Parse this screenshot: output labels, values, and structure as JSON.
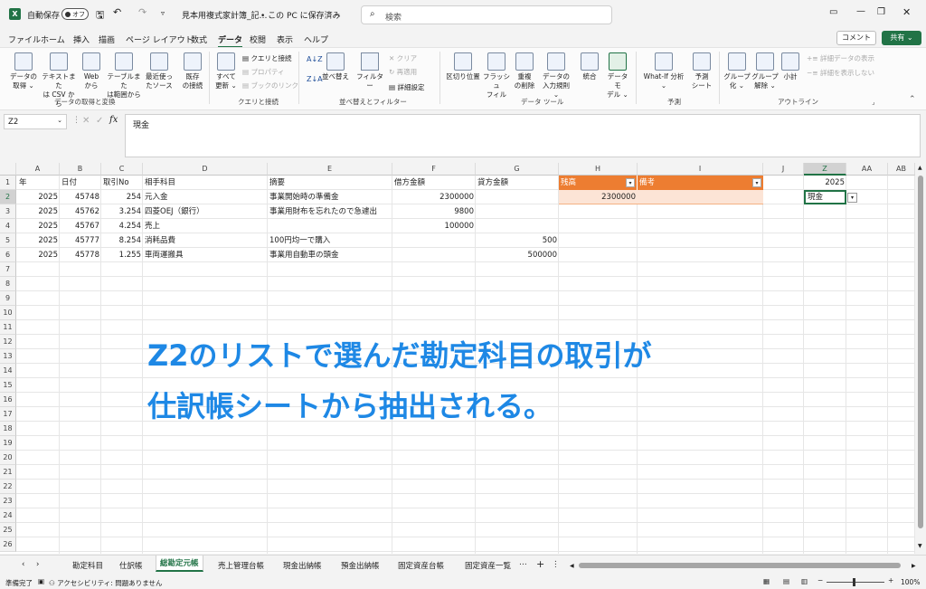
{
  "titlebar": {
    "autosave_label": "自動保存",
    "autosave_state": "オフ",
    "doc_title": "見本用複式家計簿_記…",
    "save_location": "• この PC に保存済み",
    "search_placeholder": "検索"
  },
  "menu": {
    "items": [
      "ファイル",
      "ホーム",
      "挿入",
      "描画",
      "ページ レイアウト",
      "数式",
      "データ",
      "校閲",
      "表示",
      "ヘルプ"
    ],
    "active": "データ",
    "comment_label": "コメント",
    "share_label": "共有"
  },
  "ribbon": {
    "get_data": {
      "label1": "データの",
      "label2": "取得"
    },
    "from_csv": {
      "label1": "テキストまた",
      "label2": "は CSV から"
    },
    "from_web": {
      "label1": "Web",
      "label2": "から"
    },
    "from_table": {
      "label1": "テーブルまた",
      "label2": "は範囲から"
    },
    "recent": {
      "label1": "最近使っ",
      "label2": "たソース"
    },
    "existing": {
      "label1": "既存",
      "label2": "の接続"
    },
    "group1": "データの取得と変換",
    "refresh_all": {
      "label1": "すべて",
      "label2": "更新"
    },
    "queries_connections": "クエリと接続",
    "properties": "プロパティ",
    "book_links": "ブックのリンク",
    "group2": "クエリと接続",
    "sort": "並べ替え",
    "filter": "フィルター",
    "clear": "クリア",
    "reapply": "再適用",
    "advanced": "詳細設定",
    "group3": "並べ替えとフィルター",
    "text_to_columns": "区切り位置",
    "flash_fill": {
      "label1": "フラッシュ",
      "label2": "フィル"
    },
    "remove_dup": {
      "label1": "重複",
      "label2": "の削除"
    },
    "validation": {
      "label1": "データの",
      "label2": "入力規則"
    },
    "consolidate": "統合",
    "data_model": {
      "label1": "データ モ",
      "label2": "デル"
    },
    "group4": "データ ツール",
    "whatif": {
      "label1": "What-If 分析"
    },
    "forecast": {
      "label1": "予測",
      "label2": "シート"
    },
    "group5": "予測",
    "group_btn": {
      "label1": "グループ",
      "label2": "化"
    },
    "ungroup": {
      "label1": "グループ",
      "label2": "解除"
    },
    "subtotal": "小計",
    "show_detail": "詳細データの表示",
    "hide_detail": "詳細を表示しない",
    "group6": "アウトライン"
  },
  "formula_bar": {
    "name_box": "Z2",
    "content": "現金"
  },
  "columns": [
    {
      "id": "A"
    },
    {
      "id": "B"
    },
    {
      "id": "C"
    },
    {
      "id": "D"
    },
    {
      "id": "E"
    },
    {
      "id": "F"
    },
    {
      "id": "G"
    },
    {
      "id": "H"
    },
    {
      "id": "I"
    },
    {
      "id": "J"
    },
    {
      "id": "Z"
    },
    {
      "id": "AA"
    },
    {
      "id": "AB"
    }
  ],
  "rows": [
    "1",
    "2",
    "3",
    "4",
    "5",
    "6",
    "7",
    "8",
    "9",
    "10",
    "11",
    "12",
    "13",
    "14",
    "15",
    "16",
    "17",
    "18",
    "19",
    "20",
    "21",
    "22",
    "23",
    "24",
    "25",
    "26"
  ],
  "headers_row": {
    "a": "年",
    "b": "日付",
    "c": "取引No",
    "d": "相手科目",
    "e": "摘要",
    "f": "借方金額",
    "g": "貸方金額",
    "h": "残高",
    "i": "備考",
    "z": "2025"
  },
  "data_rows": [
    {
      "a": "2025",
      "b": "45748",
      "c": "254",
      "d": "元入金",
      "e": "事業開始時の準備金",
      "f": "2300000",
      "g": "",
      "h": "2300000",
      "z": "現金"
    },
    {
      "a": "2025",
      "b": "45762",
      "c": "3.254",
      "d": "四菱OEJ（銀行）",
      "e": "事業用財布を忘れたので急遽出",
      "f": "9800",
      "g": "",
      "h": "",
      "z": ""
    },
    {
      "a": "2025",
      "b": "45767",
      "c": "4.254",
      "d": "売上",
      "e": "",
      "f": "100000",
      "g": "",
      "h": "",
      "z": ""
    },
    {
      "a": "2025",
      "b": "45777",
      "c": "8.254",
      "d": "消耗品費",
      "e": "100円均一で購入",
      "f": "",
      "g": "500",
      "h": "",
      "z": ""
    },
    {
      "a": "2025",
      "b": "45778",
      "c": "1.255",
      "d": "車両運搬具",
      "e": "事業用自動車の頭金",
      "f": "",
      "g": "500000",
      "h": "",
      "z": ""
    }
  ],
  "overlay": {
    "line1": "Z2のリストで選んだ勘定科目の取引が",
    "line2": "仕訳帳シートから抽出される。"
  },
  "sheet_tabs": [
    "勘定科目",
    "仕訳帳",
    "総勘定元帳",
    "売上管理台帳",
    "現金出納帳",
    "預金出納帳",
    "固定資産台帳",
    "固定資産一覧"
  ],
  "active_tab": "総勘定元帳",
  "status": {
    "ready": "準備完了",
    "accessibility": "アクセシビリティ: 問題ありません",
    "zoom": "100%"
  },
  "colors": {
    "table_header": "#ed7d31",
    "table_row": "#fce4d6",
    "overlay_text": "#1e88e5",
    "excel_green": "#217346"
  }
}
